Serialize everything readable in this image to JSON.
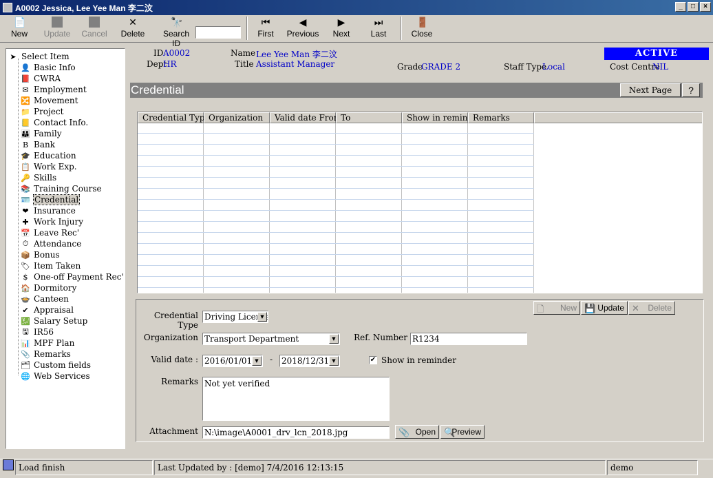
{
  "window": {
    "title": "A0002 Jessica, Lee Yee Man 李二汶"
  },
  "toolbar": {
    "new": "New",
    "update": "Update",
    "cancel": "Cancel",
    "delete": "Delete",
    "search_id": "Search ID",
    "search_value": "",
    "first": "First",
    "previous": "Previous",
    "next": "Next",
    "last": "Last",
    "close": "Close"
  },
  "tree": {
    "root": "Select Item",
    "items": [
      "Basic Info",
      "CWRA",
      "Employment",
      "Movement",
      "Project",
      "Contact Info.",
      "Family",
      "Bank",
      "Education",
      "Work Exp.",
      "Skills",
      "Training Course",
      "Credential",
      "Insurance",
      "Work Injury",
      "Leave Rec'",
      "Attendance",
      "Bonus",
      "Item Taken",
      "One-off Payment Rec'",
      "Dormitory",
      "Canteen",
      "Appraisal",
      "Salary Setup",
      "IR56",
      "MPF Plan",
      "Remarks",
      "Custom fields",
      "Web Services"
    ],
    "selected": "Credential"
  },
  "header": {
    "id_label": "ID",
    "id_value": "A0002",
    "dept_label": "Dept",
    "dept_value": "HR",
    "name_label": "Name",
    "name_value": "Lee Yee Man 李二汶",
    "title_label": "Title",
    "title_value": "Assistant Manager",
    "grade_label": "Grade",
    "grade_value": "GRADE 2",
    "staff_type_label": "Staff Type",
    "staff_type_value": "Local",
    "cost_centre_label": "Cost Centre",
    "cost_centre_value": "NIL",
    "status": "ACTIVE"
  },
  "panel": {
    "title": "Credential",
    "next_page": "Next Page",
    "help": "?"
  },
  "grid": {
    "columns": [
      "Credential Type",
      "Organization",
      "Valid date From",
      "To",
      "Show in reminder",
      "Remarks"
    ]
  },
  "form": {
    "credential_type_label": "Credential Type",
    "credential_type_value": "Driving License",
    "organization_label": "Organization",
    "organization_value": "Transport Department",
    "ref_number_label": "Ref. Number",
    "ref_number_value": "R1234",
    "valid_date_label": "Valid date :",
    "valid_from": "2016/01/01",
    "valid_dash": "-",
    "valid_to": "2018/12/31",
    "show_reminder_label": "Show in reminder",
    "show_reminder_checked": true,
    "remarks_label": "Remarks",
    "remarks_value": "Not yet verified",
    "attachment_label": "Attachment",
    "attachment_value": "N:\\image\\A0001_drv_lcn_2018.jpg",
    "new": "New",
    "update": "Update",
    "delete": "Delete",
    "open": "Open",
    "preview": "Preview"
  },
  "statusbar": {
    "message": "Load finish",
    "last_updated": "Last Updated by : [demo]  7/4/2016 12:13:15",
    "user": "demo"
  }
}
